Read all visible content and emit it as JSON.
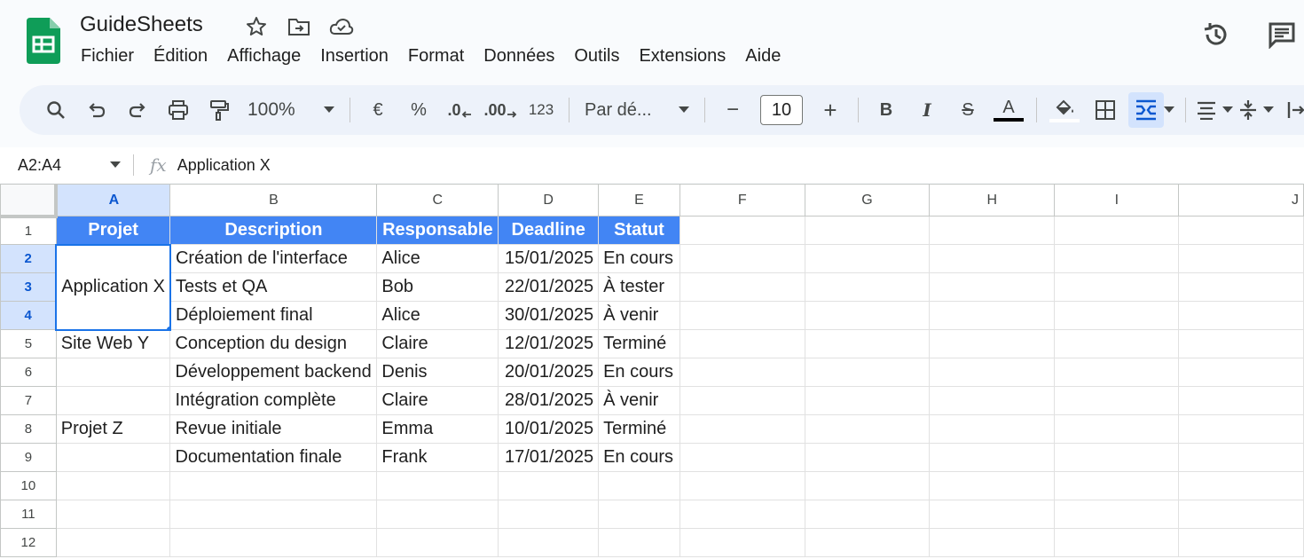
{
  "app": {
    "title": "GuideSheets",
    "menu": [
      "Fichier",
      "Édition",
      "Affichage",
      "Insertion",
      "Format",
      "Données",
      "Outils",
      "Extensions",
      "Aide"
    ]
  },
  "toolbar": {
    "zoom": "100%",
    "currency": "€",
    "percent": "%",
    "dec_decrease": ".0",
    "dec_increase": ".00",
    "number_format": "123",
    "font": "Par dé...",
    "font_size": "10",
    "minus": "−",
    "plus": "+",
    "bold": "B",
    "italic": "I",
    "strike": "S",
    "text_color": "A",
    "colors": {
      "text": "#000000",
      "accent": "#1a73e8",
      "header_fill": "#4285f4"
    }
  },
  "formula_bar": {
    "name_box": "A2:A4",
    "fx": "fx",
    "value": "Application X"
  },
  "grid": {
    "columns": [
      "A",
      "B",
      "C",
      "D",
      "E",
      "F",
      "G",
      "H",
      "I",
      "J"
    ],
    "rows": [
      "1",
      "2",
      "3",
      "4",
      "5",
      "6",
      "7",
      "8",
      "9",
      "10",
      "11",
      "12"
    ],
    "header": [
      "Projet",
      "Description",
      "Responsable",
      "Deadline",
      "Statut"
    ],
    "merged_a2_a4": "Application X",
    "data": [
      {
        "a": "",
        "b": "Création de l'interface",
        "c": "Alice",
        "d": "15/01/2025",
        "e": "En cours"
      },
      {
        "a": "",
        "b": "Tests et QA",
        "c": "Bob",
        "d": "22/01/2025",
        "e": "À tester"
      },
      {
        "a": "",
        "b": "Déploiement final",
        "c": "Alice",
        "d": "30/01/2025",
        "e": "À venir"
      },
      {
        "a": "Site Web Y",
        "b": "Conception du design",
        "c": "Claire",
        "d": "12/01/2025",
        "e": "Terminé"
      },
      {
        "a": "",
        "b": "Développement backend",
        "c": "Denis",
        "d": "20/01/2025",
        "e": "En cours"
      },
      {
        "a": "",
        "b": "Intégration complète",
        "c": "Claire",
        "d": "28/01/2025",
        "e": "À venir"
      },
      {
        "a": "Projet Z",
        "b": "Revue initiale",
        "c": "Emma",
        "d": "10/01/2025",
        "e": "Terminé"
      },
      {
        "a": "",
        "b": "Documentation finale",
        "c": "Frank",
        "d": "17/01/2025",
        "e": "En cours"
      }
    ]
  }
}
